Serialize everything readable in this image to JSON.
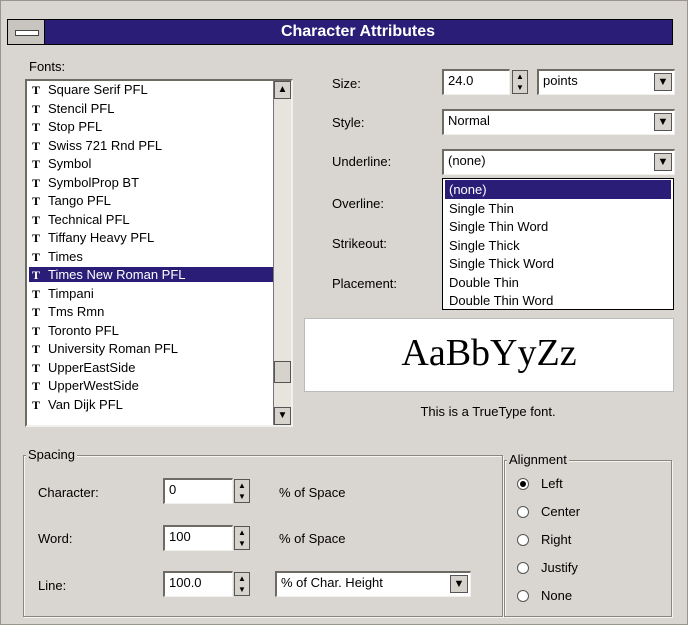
{
  "window": {
    "title": "Character Attributes",
    "accent_color": "#2a1d78"
  },
  "fonts": {
    "label": "Fonts:",
    "items": [
      "Square Serif PFL",
      "Stencil PFL",
      "Stop PFL",
      "Swiss 721 Rnd PFL",
      "Symbol",
      "SymbolProp BT",
      "Tango PFL",
      "Technical PFL",
      "Tiffany Heavy PFL",
      "Times",
      "Times New Roman PFL",
      "Timpani",
      "Tms Rmn",
      "Toronto PFL",
      "University Roman PFL",
      "UpperEastSide",
      "UpperWestSide",
      "Van Dijk PFL"
    ],
    "selected": "Times New Roman PFL",
    "icon": "truetype-icon"
  },
  "size": {
    "label": "Size:",
    "value": "24.0",
    "unit": "points"
  },
  "style": {
    "label": "Style:",
    "value": "Normal"
  },
  "underline": {
    "label": "Underline:",
    "value": "(none)",
    "options": [
      "(none)",
      "Single Thin",
      "Single Thin Word",
      "Single Thick",
      "Single Thick Word",
      "Double Thin",
      "Double Thin Word"
    ]
  },
  "overline": {
    "label": "Overline:"
  },
  "strikeout": {
    "label": "Strikeout:"
  },
  "placement": {
    "label": "Placement:"
  },
  "preview": {
    "sample": "AaBbYyZz",
    "note": "This is a TrueType font."
  },
  "spacing": {
    "title": "Spacing",
    "character": {
      "label": "Character:",
      "value": "0",
      "unit": "% of Space"
    },
    "word": {
      "label": "Word:",
      "value": "100",
      "unit": "% of Space"
    },
    "line": {
      "label": "Line:",
      "value": "100.0",
      "unit": "% of Char. Height"
    }
  },
  "alignment": {
    "title": "Alignment",
    "options": [
      "Left",
      "Center",
      "Right",
      "Justify",
      "None"
    ],
    "selected": "Left"
  }
}
